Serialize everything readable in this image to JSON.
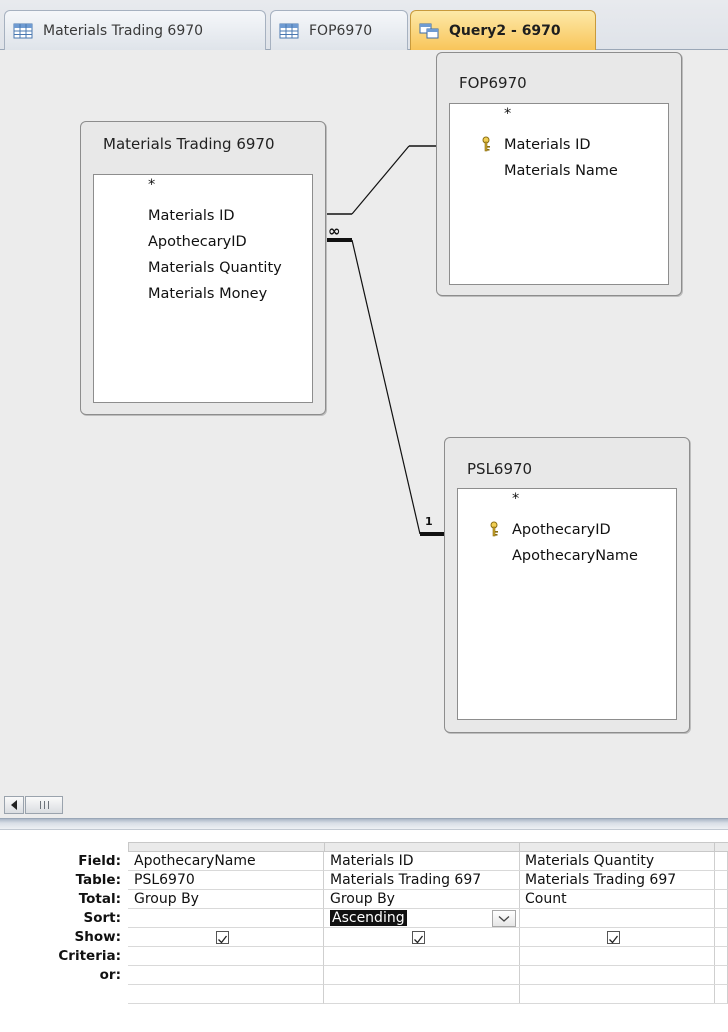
{
  "tabs": [
    {
      "label": "Materials Trading 6970",
      "icon": "table-icon",
      "active": false
    },
    {
      "label": "FOP6970",
      "icon": "table-icon",
      "active": false
    },
    {
      "label": "Query2 - 6970",
      "icon": "query-icon",
      "active": true
    }
  ],
  "tables": {
    "materials_trading": {
      "title": "Materials Trading 6970",
      "fields": [
        "*",
        "Materials ID",
        "ApothecaryID",
        "Materials Quantity",
        "Materials Money"
      ]
    },
    "fop": {
      "title": "FOP6970",
      "fields": [
        "*",
        "Materials ID",
        "Materials Name"
      ],
      "primary_key": "Materials ID"
    },
    "psl": {
      "title": "PSL6970",
      "fields": [
        "*",
        "ApothecaryID",
        "ApothecaryName"
      ],
      "primary_key": "ApothecaryID"
    }
  },
  "joins": {
    "one_side_label": "1",
    "many_side_label": "∞"
  },
  "qbe": {
    "row_labels": [
      "Field:",
      "Table:",
      "Total:",
      "Sort:",
      "Show:",
      "Criteria:",
      "or:"
    ],
    "columns": [
      {
        "field": "ApothecaryName",
        "table": "PSL6970",
        "total": "Group By",
        "sort": "",
        "show": true
      },
      {
        "field": "Materials ID",
        "table": "Materials Trading 697",
        "total": "Group By",
        "sort": "Ascending",
        "show": true
      },
      {
        "field": "Materials Quantity",
        "table": "Materials Trading 697",
        "total": "Count",
        "sort": "",
        "show": true
      }
    ]
  },
  "colors": {
    "active_tab": "#f8c55a",
    "canvas": "#ececec",
    "selected_cell_bg": "#111111"
  }
}
